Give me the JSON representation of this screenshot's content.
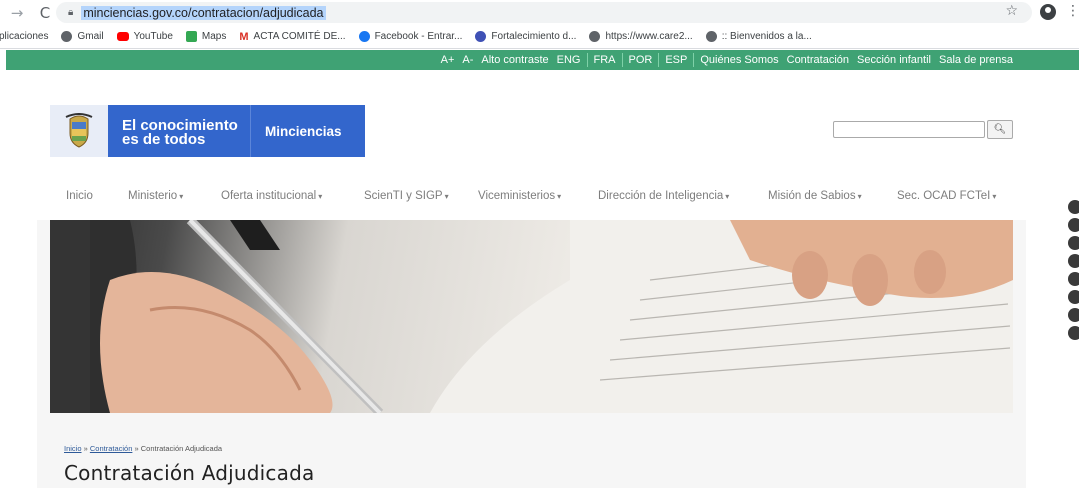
{
  "browser": {
    "url": "minciencias.gov.co/contratacion/adjudicada"
  },
  "bookmarks": [
    {
      "label": "plicaciones",
      "color": "#ffffff"
    },
    {
      "label": "Gmail",
      "color": "#5f6368"
    },
    {
      "label": "YouTube",
      "color": "#ff0000"
    },
    {
      "label": "Maps",
      "color": "#34a853"
    },
    {
      "label": "ACTA COMITÉ DE...",
      "color": "#d93025"
    },
    {
      "label": "Facebook - Entrar...",
      "color": "#1877f2"
    },
    {
      "label": "Fortalecimiento d...",
      "color": "#3f51b5"
    },
    {
      "label": "https://www.care2...",
      "color": "#5f6368"
    },
    {
      "label": ":: Bienvenidos a la...",
      "color": "#5f6368"
    }
  ],
  "gov_bar": {
    "items": [
      "A+",
      "A-",
      "Alto contraste",
      "ENG",
      "FRA",
      "POR",
      "ESP",
      "Quiénes Somos",
      "Contratación",
      "Sección infantil",
      "Sala de prensa"
    ]
  },
  "header": {
    "brand_line1": "El conocimiento",
    "brand_line2": "es de todos",
    "brand_name": "Minciencias",
    "search_placeholder": ""
  },
  "menu": [
    {
      "label": "Inicio",
      "caret": false
    },
    {
      "label": "Ministerio",
      "caret": true
    },
    {
      "label": "Oferta institucional",
      "caret": true
    },
    {
      "label": "ScienTI y SIGP",
      "caret": true
    },
    {
      "label": "Viceministerios",
      "caret": true
    },
    {
      "label": "Dirección de Inteligencia",
      "caret": true
    },
    {
      "label": "Misión de Sabios",
      "caret": true
    },
    {
      "label": "Sec. OCAD FCTeI",
      "caret": true
    }
  ],
  "breadcrumb": {
    "home": "Inicio",
    "sep": "»",
    "section": "Contratación",
    "current": "Contratación Adjudicada"
  },
  "page_title": "Contratación Adjudicada",
  "social_icons": [
    "facebook-icon",
    "twitter-icon",
    "instagram-icon",
    "youtube-icon",
    "linkedin-icon",
    "flickr-icon",
    "rss-icon",
    "spotify-icon"
  ]
}
